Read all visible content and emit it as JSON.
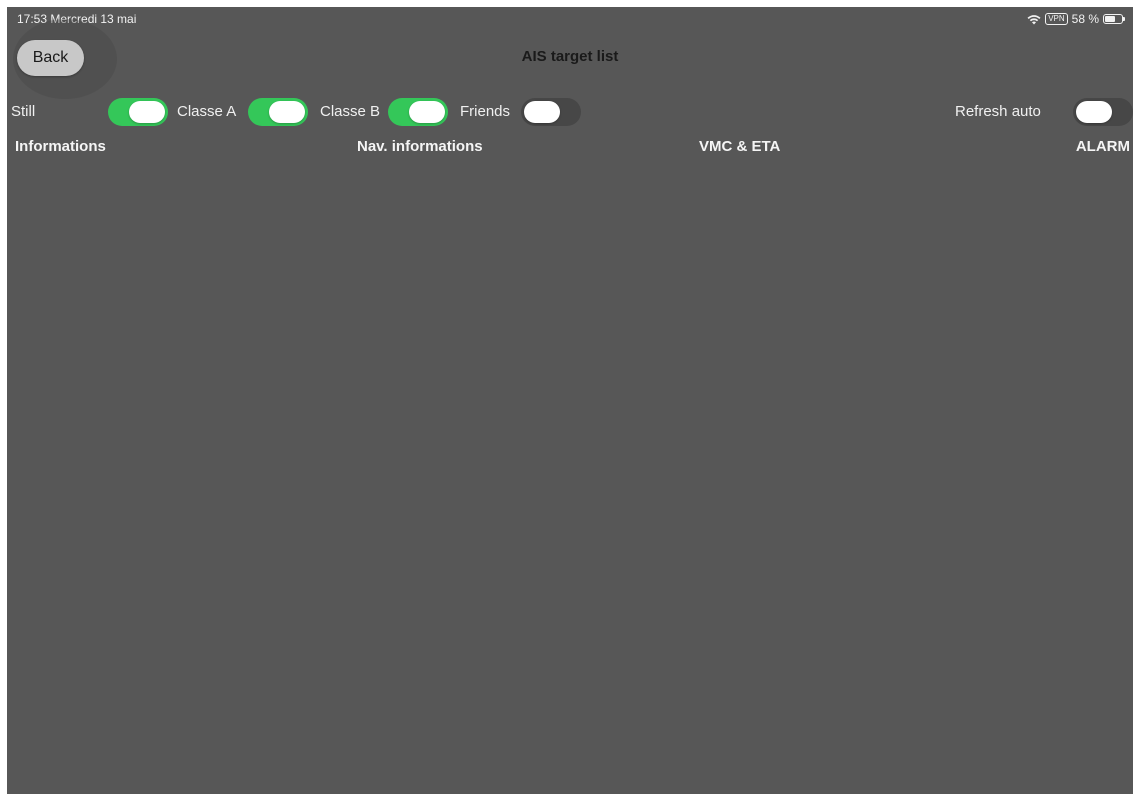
{
  "status_bar": {
    "time_date": "17:53  Mercredi 13 mai",
    "vpn": "VPN",
    "battery": "58 %",
    "icons": [
      "wifi-icon",
      "vpn-icon",
      "battery-icon"
    ]
  },
  "nav": {
    "back_label": "Back",
    "title": "AIS target list"
  },
  "filters": {
    "still": {
      "label": "Still",
      "on": true
    },
    "classe_a": {
      "label": "Classe A",
      "on": true
    },
    "classe_b": {
      "label": "Classe B",
      "on": true
    },
    "friends": {
      "label": "Friends",
      "on": false
    },
    "refresh_auto": {
      "label": "Refresh auto",
      "on": false
    }
  },
  "columns": [
    "Informations",
    "Nav. informations",
    "VMC & ETA",
    "ALARM"
  ],
  "colors": {
    "background": "#575757",
    "toggle_on": "#34c759",
    "toggle_off": "#474747"
  }
}
